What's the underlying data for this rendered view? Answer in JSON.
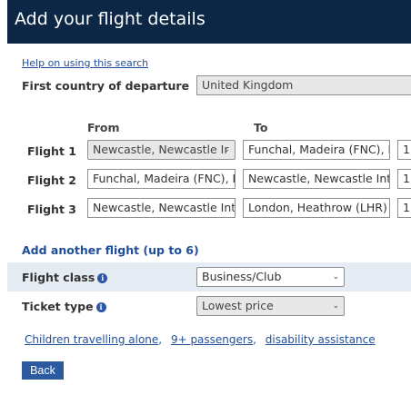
{
  "header": {
    "title": "Add your flight details"
  },
  "help": {
    "link": "Help on using this search"
  },
  "departure": {
    "label": "First country of departure",
    "value": "United Kingdom"
  },
  "columns": {
    "from": "From",
    "to": "To"
  },
  "flights": [
    {
      "label": "Flight 1",
      "from": "Newcastle, Newcastle Ir",
      "to": "Funchal, Madeira (FNC), F",
      "date": "1"
    },
    {
      "label": "Flight 2",
      "from": "Funchal, Madeira (FNC), F",
      "to": "Newcastle, Newcastle Int",
      "date": "1"
    },
    {
      "label": "Flight 3",
      "from": "Newcastle, Newcastle Int",
      "to": "London, Heathrow (LHR)",
      "date": "1"
    }
  ],
  "add_flight": {
    "label": "Add another flight (up to 6)"
  },
  "flight_class": {
    "label": "Flight class",
    "value": "Business/Club"
  },
  "ticket_type": {
    "label": "Ticket type",
    "value": "Lowest price"
  },
  "links": {
    "children": "Children travelling alone",
    "passengers": "9+ passengers",
    "disability": "disability assistance",
    "separator": ","
  },
  "actions": {
    "back": "Back"
  },
  "icons": {
    "info": "i",
    "chevron": "⌄"
  },
  "colors": {
    "header_bg": "#0b2745",
    "link": "#1f4e9a",
    "band": "#e6ecf3",
    "button": "#2b5aa0"
  }
}
